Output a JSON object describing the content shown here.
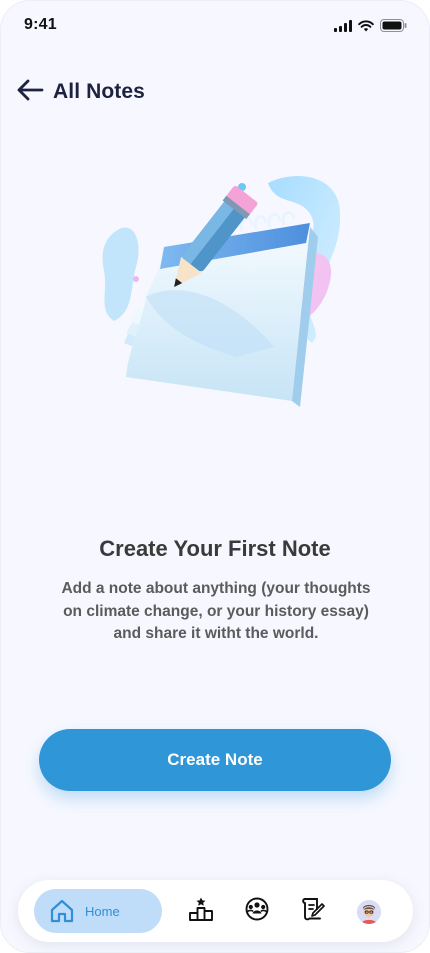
{
  "status_bar": {
    "time": "9:41",
    "icons": [
      "signal-icon",
      "wifi-icon",
      "battery-icon"
    ]
  },
  "header": {
    "back_icon": "arrow-left-icon",
    "title": "All Notes"
  },
  "empty_state": {
    "illustration": "notepad-with-pencil-illustration",
    "title": "Create Your First Note",
    "description": "Add a note about anything (your thoughts on climate change, or your history essay) and share it witht the world."
  },
  "primary_action": {
    "label": "Create Note"
  },
  "bottom_nav": {
    "items": [
      {
        "label": "Home",
        "icon": "home-icon",
        "active": true
      },
      {
        "label": "",
        "icon": "podium-icon",
        "active": false
      },
      {
        "label": "",
        "icon": "community-globe-icon",
        "active": false
      },
      {
        "label": "",
        "icon": "scroll-pen-icon",
        "active": false
      },
      {
        "label": "",
        "icon": "avatar",
        "active": false
      }
    ]
  },
  "colors": {
    "background": "#f7f8ff",
    "accent": "#2f97d8",
    "nav_active_bg": "#bfdcf8",
    "title_text": "#1d2240"
  }
}
